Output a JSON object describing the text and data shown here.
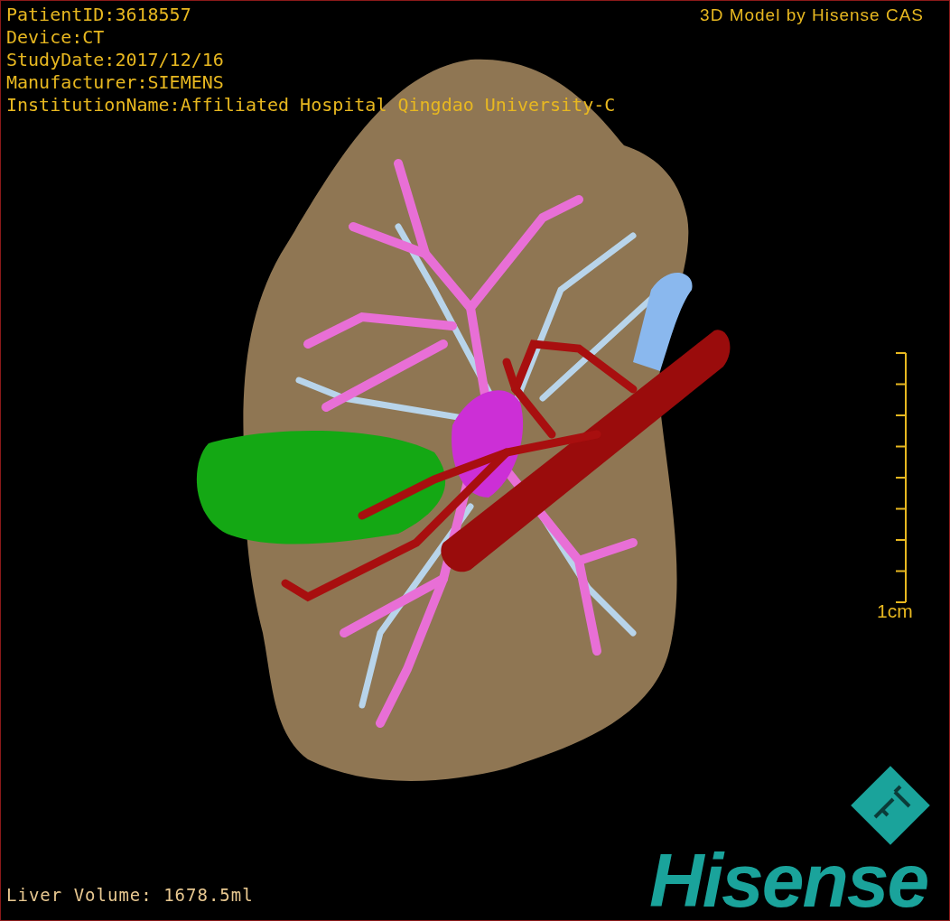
{
  "patient_info": [
    "PatientID:3618557",
    "Device:CT",
    "StudyDate:2017/12/16",
    "Manufacturer:SIEMENS",
    "InstitutionName:Affiliated Hospital Qingdao University-C"
  ],
  "model_credit": "3D Model by Hisense CAS",
  "scale_bar": {
    "label": "1cm"
  },
  "liver_volume": "Liver Volume: 1678.5ml",
  "brand": "Hisense"
}
